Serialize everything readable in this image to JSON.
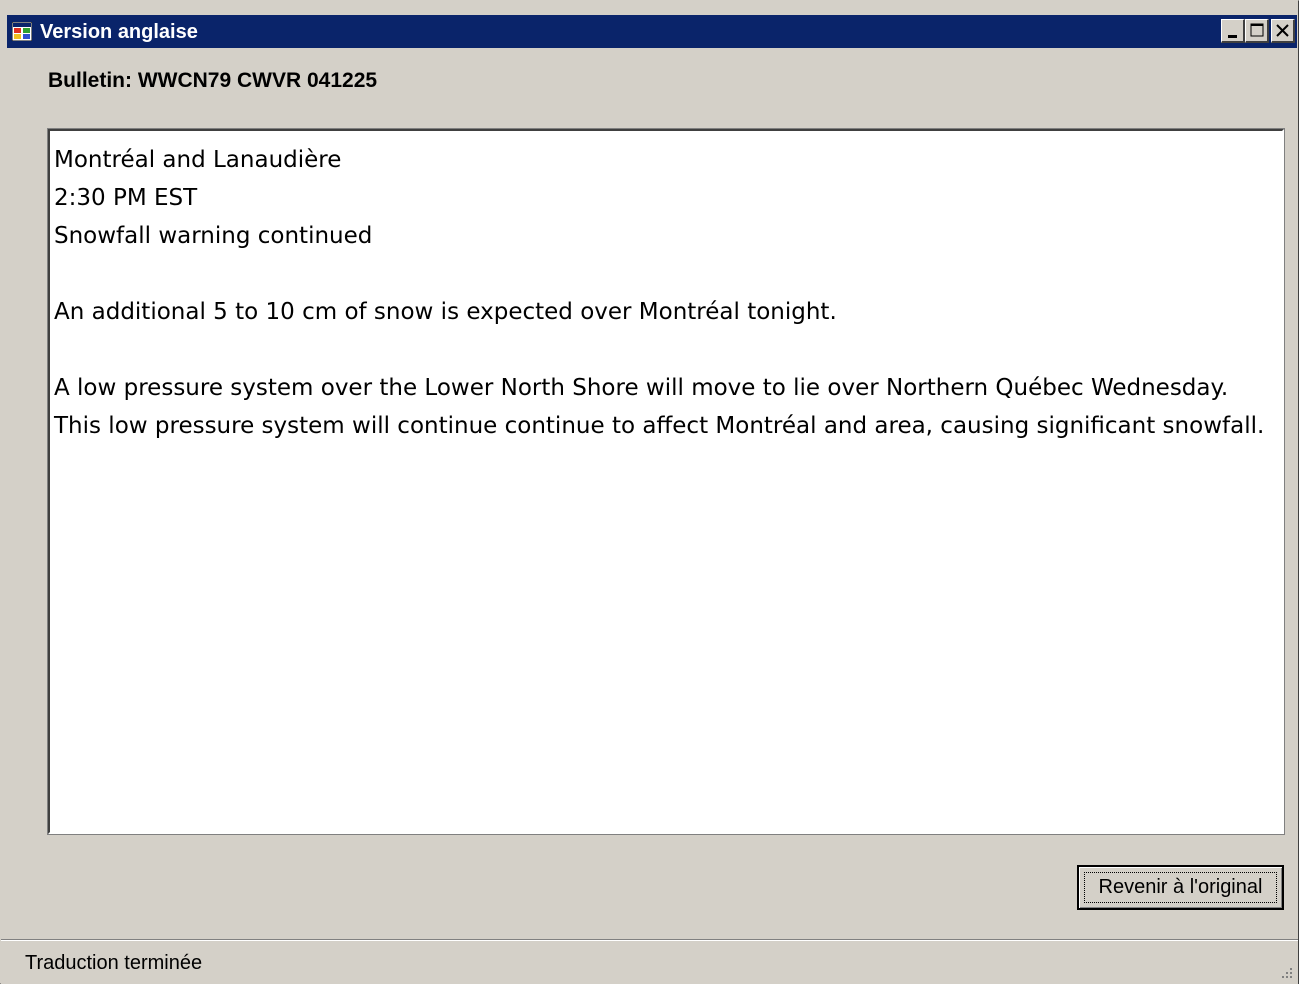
{
  "window": {
    "title": "Version anglaise",
    "icon": "app-window-icon",
    "controls": [
      "minimize-icon",
      "maximize-icon",
      "close-icon"
    ]
  },
  "bulletin": {
    "label": "Bulletin: WWCN79 CWVR 041225"
  },
  "document": {
    "line1": "Montréal and Lanaudière",
    "line2": "2:30 PM EST",
    "line3": "Snowfall warning continued",
    "paragraph1": "An additional 5 to 10 cm of snow is expected over Montréal tonight.",
    "paragraph2": "A low pressure system over the Lower North Shore will move to lie over Northern Québec Wednesday. This low pressure system will continue continue to affect Montréal and area, causing significant snowfall."
  },
  "buttons": {
    "revert_label": "Revenir à l'original"
  },
  "status": {
    "text": "Traduction terminée"
  },
  "colors": {
    "titlebar": "#0a246a",
    "face": "#d4d0c8"
  }
}
